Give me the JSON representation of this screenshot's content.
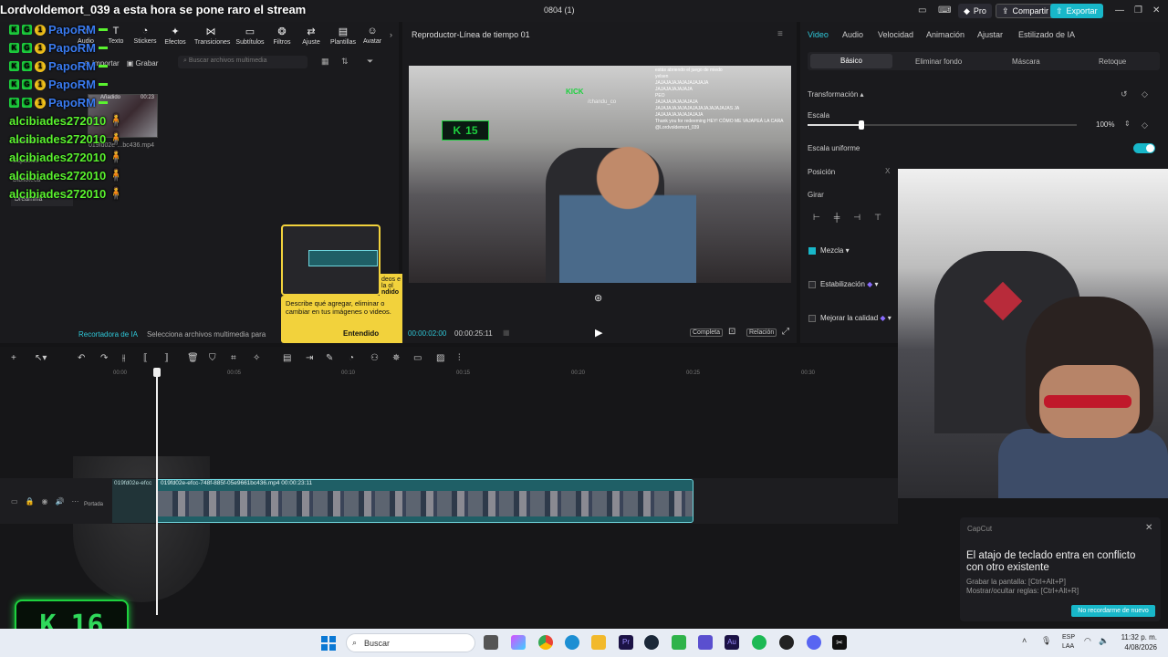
{
  "titlebar": {
    "stream_title": "Lordvoldemort_039  a esta hora se pone raro el stream",
    "document_title": "0804 (1)",
    "pro_label": "Pro",
    "share_label": "Compartir",
    "export_label": "Exportar"
  },
  "toolbar": {
    "items": [
      {
        "label": "Audio",
        "icon": "music-icon"
      },
      {
        "label": "Texto",
        "icon": "text-icon"
      },
      {
        "label": "Stickers",
        "icon": "sticker-icon"
      },
      {
        "label": "Efectos",
        "icon": "sparkle-icon"
      },
      {
        "label": "Transiciones",
        "icon": "transition-icon"
      },
      {
        "label": "Subtítulos",
        "icon": "captions-icon"
      },
      {
        "label": "Filtros",
        "icon": "filter-icon"
      },
      {
        "label": "Ajuste",
        "icon": "adjust-icon"
      },
      {
        "label": "Plantillas",
        "icon": "template-icon"
      },
      {
        "label": "Avatar",
        "icon": "avatar-icon"
      }
    ]
  },
  "media": {
    "import_label": "Importar",
    "record_label": "Grabar",
    "search_placeholder": "Buscar archivos multimedia",
    "thumb_added": "Añadido",
    "thumb_duration": "00:23",
    "thumb_name": "019fd02e-...bc436.mp4",
    "side_nav": [
      "General",
      "Espacios",
      "Biblioteca",
      "Dreamina"
    ]
  },
  "chat_overlay": [
    {
      "name": "PapoRM",
      "color": "blue"
    },
    {
      "name": "PapoRM",
      "color": "blue"
    },
    {
      "name": "PapoRM",
      "color": "blue"
    },
    {
      "name": "PapoRM",
      "color": "blue"
    },
    {
      "name": "PapoRM",
      "color": "blue"
    },
    {
      "name": "alcibiades272010",
      "color": "green"
    },
    {
      "name": "alcibiades272010",
      "color": "green"
    },
    {
      "name": "alcibiades272010",
      "color": "green"
    },
    {
      "name": "alcibiades272010",
      "color": "green"
    },
    {
      "name": "alcibiades272010",
      "color": "green"
    }
  ],
  "ai_bar": {
    "title": "Recortadora de IA",
    "hint": "Selecciona archivos multimedia para"
  },
  "tooltip": {
    "text": "Describe qué agregar, eliminar o cambiar en tus imágenes o videos.",
    "button": "Entendido",
    "back_text": "deos e la ol",
    "back_button": "ndido"
  },
  "player": {
    "title": "Reproductor-Línea de tiempo 01",
    "current_time": "00:00:02:00",
    "total_time": "00:00:25:11",
    "full_label": "Completa",
    "ratio_label": "Relación",
    "kick_counter": "15",
    "kick_logo": "KICK",
    "kick_logo_sub": "/chandu_co",
    "chat_lines": [
      "estás abriendo el juego de miedo",
      "yelsen",
      "JAJAJAJAJAJAJAJAJAJA",
      "JAJAJAJAJAJAJA",
      "PEO",
      "JAJAJAJAJAJAJAJA",
      "JAJAJAJAJAJAJAJAJAJAJAJAJAJAS JA",
      "JAJAJAJAJAJAJAJAJA",
      "Thank you for redeeming HEY! CÓMO ME VAJAPEÁ LA CARA @Lordvoldemort_039"
    ]
  },
  "inspector": {
    "tabs": [
      "Video",
      "Audio",
      "Velocidad",
      "Animación",
      "Ajustar",
      "Estilizado de IA"
    ],
    "subtabs": [
      "Básico",
      "Eliminar fondo",
      "Máscara",
      "Retoque"
    ],
    "transform_label": "Transformación",
    "scale_label": "Escala",
    "scale_value": "100%",
    "scale_fraction": 0.2,
    "uniform_label": "Escala uniforme",
    "position_label": "Posición",
    "rotate_label": "Girar",
    "blend_label": "Mezcla",
    "stabilize_label": "Estabilización",
    "enhance_label": "Mejorar la calidad"
  },
  "timeline": {
    "ruler": [
      "00:00",
      "00:05",
      "00:10",
      "00:15",
      "00:20",
      "00:25",
      "00:30"
    ],
    "clip_label": "019fd02e-efcc-748f-885f-05e9661bc436.mp4   00:00:23:11",
    "ghost_label": "019fd02e-efcc",
    "cover_label": "Portada"
  },
  "kick_big": {
    "counter": "16"
  },
  "notification": {
    "app": "CapCut",
    "title": "El atajo de teclado entra en conflicto con otro existente",
    "line1": "Grabar la pantalla: [Ctrl+Alt+P]",
    "line2": "Mostrar/ocultar reglas: [Ctrl+Alt+R]",
    "button": "No recordarme de nuevo"
  },
  "taskbar": {
    "search_label": "Buscar",
    "lang1": "ESP",
    "lang2": "LAA",
    "time": "11:32 p. m.",
    "date": "4/08/2026"
  },
  "colors": {
    "accent": "#18b7c9",
    "kick_green": "#1dd13e",
    "tooltip_yellow": "#f2d23c"
  }
}
